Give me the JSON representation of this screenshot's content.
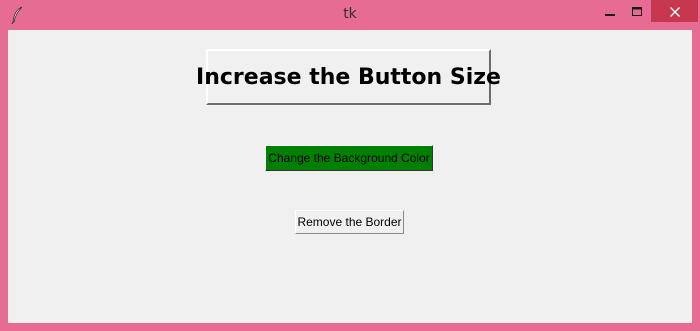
{
  "window": {
    "title": "tk",
    "frame_color": "#e76c94",
    "client_bg": "#f0f0f0",
    "close_button_color": "#c7384f",
    "icons": {
      "app": "feather-icon",
      "minimize": "minimize-icon",
      "maximize": "maximize-icon",
      "close": "close-icon"
    }
  },
  "buttons": {
    "increase_size": {
      "label": "Increase the Button Size"
    },
    "change_bg": {
      "label": "Change the Background Color",
      "bg_color": "#008000"
    },
    "remove_border": {
      "label": "Remove the Border"
    }
  }
}
